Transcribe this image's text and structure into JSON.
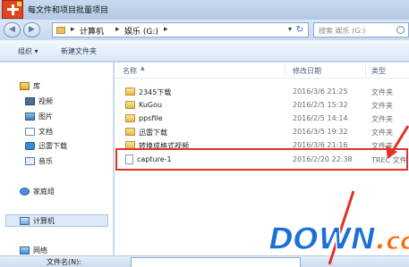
{
  "window": {
    "title": "每文件和项目批量项目"
  },
  "address": {
    "crumbs": [
      "计算机",
      "娱乐 (G:)"
    ],
    "search_placeholder": "搜索 娱乐 (G:)"
  },
  "toolbar": {
    "organize_label": "组织 ▾",
    "new_folder_label": "新建文件夹"
  },
  "nav": {
    "library_label": "库",
    "items": [
      {
        "label": "视频",
        "icon": "video-icon"
      },
      {
        "label": "图片",
        "icon": "picture-icon"
      },
      {
        "label": "文档",
        "icon": "document-icon"
      },
      {
        "label": "迅雷下载",
        "icon": "thunder-download-icon"
      },
      {
        "label": "音乐",
        "icon": "music-icon"
      }
    ],
    "homegroup_label": "家庭组",
    "computer_label": "计算机",
    "network_label": "网络"
  },
  "columns": {
    "name": "名称",
    "modified": "修改日期",
    "type": "类型"
  },
  "files": [
    {
      "name": "2345下载",
      "date": "2016/3/6 21:25",
      "type": "文件夹",
      "kind": "folder"
    },
    {
      "name": "KuGou",
      "date": "2016/2/5 15:32",
      "type": "文件夹",
      "kind": "folder"
    },
    {
      "name": "ppsfile",
      "date": "2016/2/5 14:14",
      "type": "文件夹",
      "kind": "folder"
    },
    {
      "name": "迅雷下载",
      "date": "2016/3/5 19:32",
      "type": "文件夹",
      "kind": "folder"
    },
    {
      "name": "转换成格式视频",
      "date": "2016/3/6 21:16",
      "type": "文件夹",
      "kind": "folder"
    },
    {
      "name": "capture-1",
      "date": "2016/2/20 22:38",
      "type": "TREC 文件",
      "kind": "file"
    }
  ],
  "bottom": {
    "filename_label": "文件名(N):"
  },
  "watermark": {
    "main": "DOWN",
    "dot": ".",
    "tld": "cc"
  },
  "colors": {
    "highlight": "#e0332a",
    "watermark_blue": "#1c6fd6",
    "watermark_orange": "#ff6a00"
  }
}
